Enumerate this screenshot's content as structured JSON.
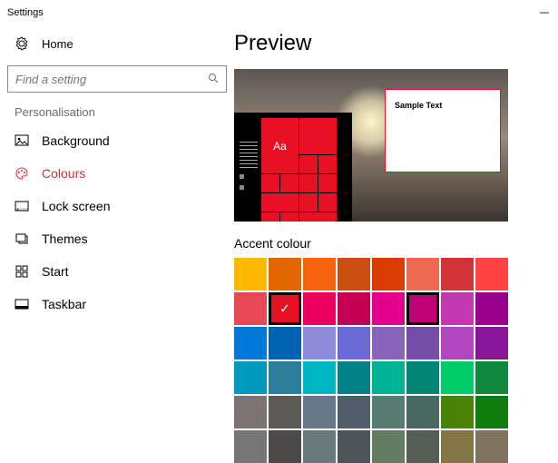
{
  "window": {
    "title": "Settings"
  },
  "sidebar": {
    "home_label": "Home",
    "search_placeholder": "Find a setting",
    "group_label": "Personalisation",
    "items": [
      {
        "label": "Background",
        "icon": "background-icon"
      },
      {
        "label": "Colours",
        "icon": "colours-icon",
        "active": true
      },
      {
        "label": "Lock screen",
        "icon": "lock-screen-icon"
      },
      {
        "label": "Themes",
        "icon": "themes-icon"
      },
      {
        "label": "Start",
        "icon": "start-icon"
      },
      {
        "label": "Taskbar",
        "icon": "taskbar-icon"
      }
    ]
  },
  "main": {
    "preview_heading": "Preview",
    "preview": {
      "tile_text": "Aa",
      "window_sample_text": "Sample Text"
    },
    "accent_heading": "Accent colour",
    "swatches": [
      "#FFB900",
      "#E36701",
      "#F7630C",
      "#CA5010",
      "#DA3B01",
      "#EF6950",
      "#D13438",
      "#FF4343",
      "#E74856",
      "#E81123",
      "#EA005E",
      "#C30052",
      "#E3008C",
      "#BF0077",
      "#C239B3",
      "#9A0089",
      "#0078D7",
      "#0063B1",
      "#8E8CD8",
      "#6B69D6",
      "#8764B8",
      "#744DA9",
      "#B146C2",
      "#881798",
      "#0099BC",
      "#2D7D9A",
      "#00B7C3",
      "#038387",
      "#00B294",
      "#018574",
      "#00CC6A",
      "#10893E",
      "#7A7574",
      "#5D5A58",
      "#68768A",
      "#515C6B",
      "#567C73",
      "#486860",
      "#498205",
      "#107C10",
      "#767676",
      "#4C4A48",
      "#69797E",
      "#4A5459",
      "#647C64",
      "#525E54",
      "#847545",
      "#7E735F"
    ],
    "selected_index": 9,
    "highlighted_index": 13
  }
}
